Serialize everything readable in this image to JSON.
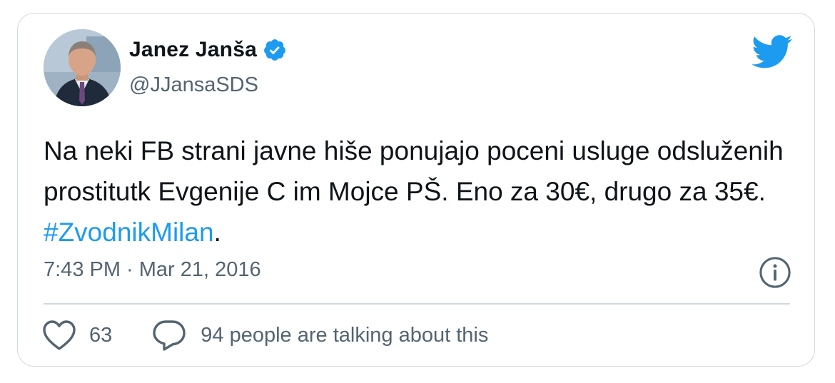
{
  "user": {
    "name": "Janez Janša",
    "handle": "@JJansaSDS",
    "avatar": "profile-photo",
    "verified": true
  },
  "tweet": {
    "text_before_hashtag": "Na neki FB strani javne hiše ponujajo poceni usluge odsluženih prostitutk Evgenije C im Mojce PŠ. Eno za 30€, drugo za 35€. ",
    "hashtag": "#ZvodnikMilan",
    "text_after_hashtag": ".",
    "timestamp": "7:43 PM · Mar 21, 2016"
  },
  "actions": {
    "like_count": "63",
    "talking_text": "94 people are talking about this"
  },
  "colors": {
    "twitter_blue": "#1d9bf0",
    "secondary_text": "#536471",
    "border": "#cfd9de"
  },
  "icons": [
    "twitter-bird-icon",
    "verified-badge-icon",
    "info-icon",
    "heart-icon",
    "reply-icon"
  ]
}
